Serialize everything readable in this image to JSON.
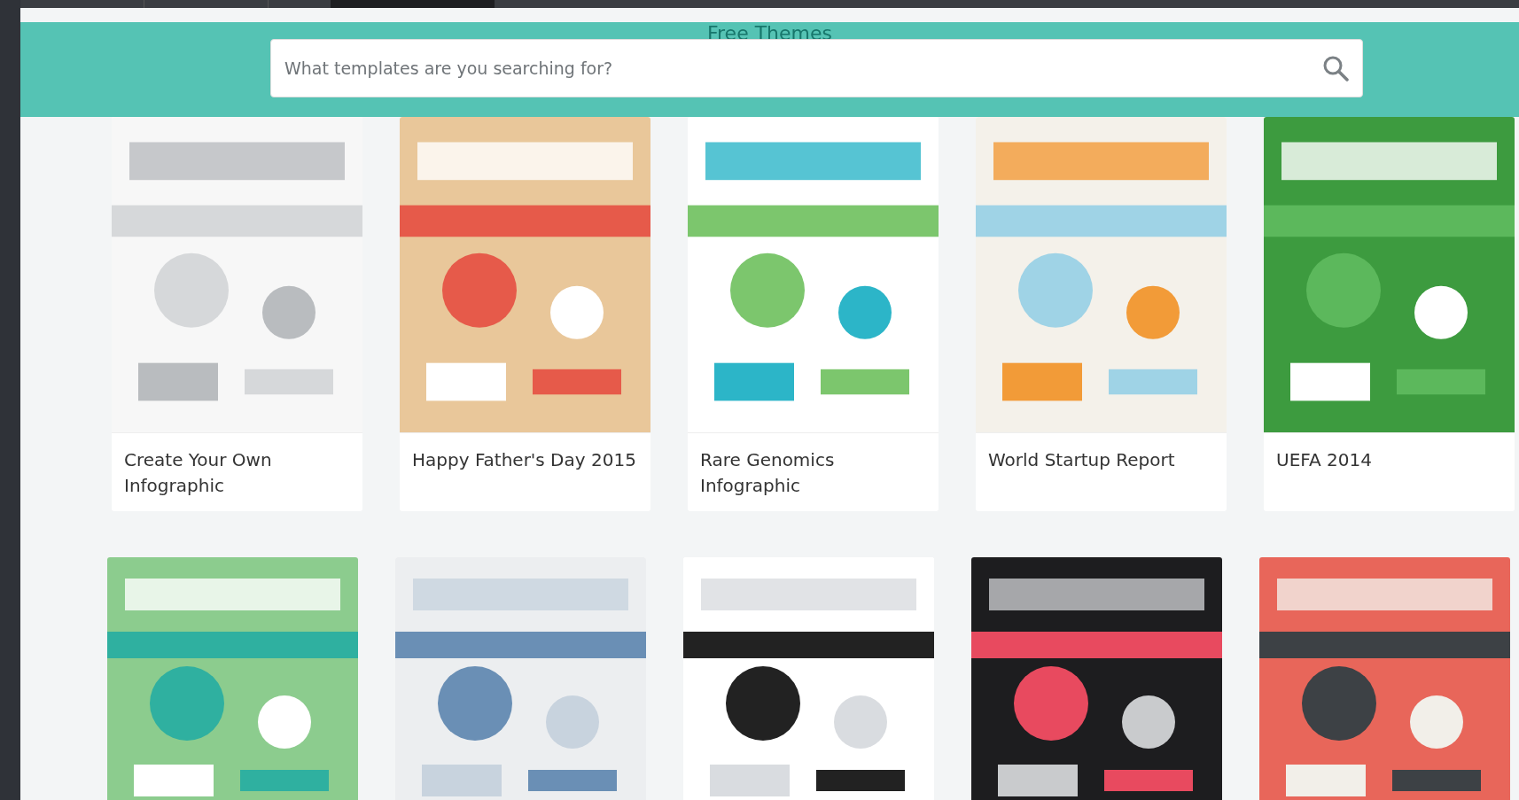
{
  "header": {
    "title": "Free Themes"
  },
  "search": {
    "placeholder": "What templates are you searching for?"
  },
  "templates": [
    {
      "title": "Create Your Own Infographic",
      "thumbnail": {
        "kind": "picture"
      }
    },
    {
      "title": "Happy Father's Day 2015",
      "thumbnail": {
        "kind": "picture"
      }
    },
    {
      "title": "Rare Genomics Infographic",
      "thumbnail": {
        "kind": "picture"
      }
    },
    {
      "title": "World Startup Report",
      "thumbnail": {
        "kind": "picture"
      }
    },
    {
      "title": "UEFA 2014",
      "thumbnail": {
        "kind": "picture"
      }
    },
    {
      "thumbnail": {
        "kind": "picture"
      }
    },
    {
      "thumbnail": {
        "kind": "picture"
      }
    },
    {
      "thumbnail": {
        "kind": "picture"
      }
    },
    {
      "thumbnail": {
        "kind": "picture"
      }
    },
    {
      "thumbnail": {
        "kind": "picture"
      }
    }
  ]
}
